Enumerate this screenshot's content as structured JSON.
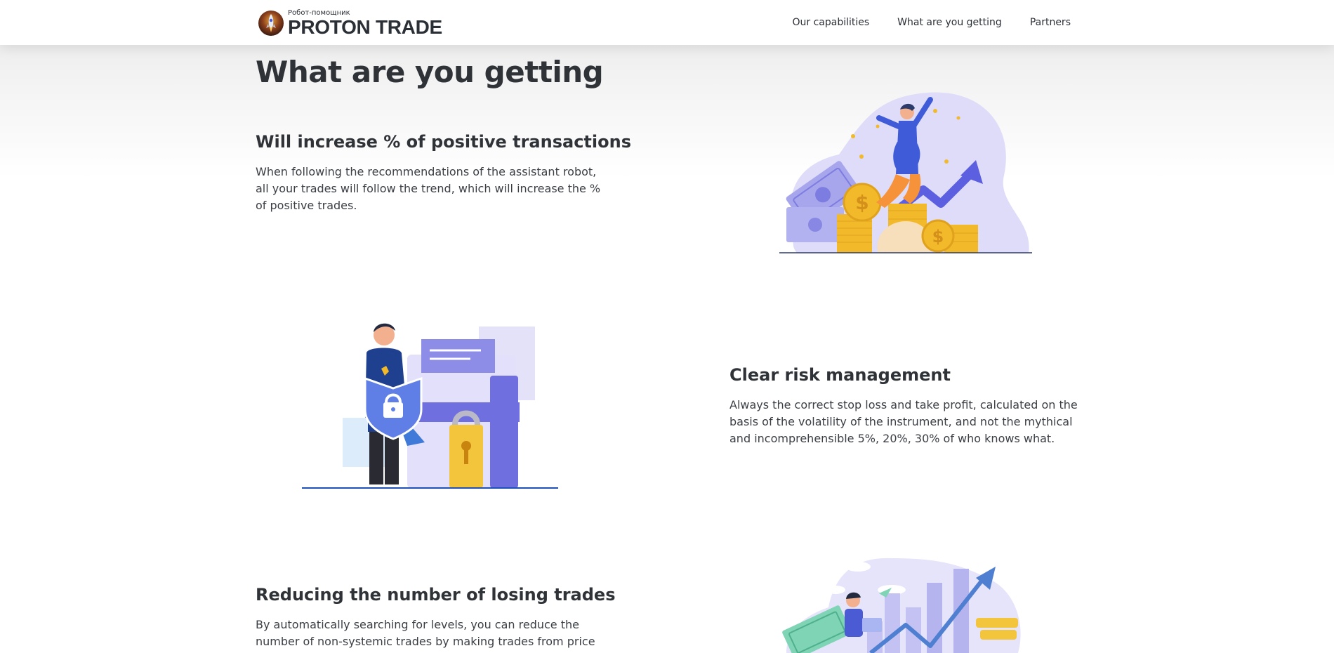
{
  "header": {
    "logo_subtitle": "Робот-помощник",
    "logo_title": "PROTON TRADE",
    "nav": [
      {
        "label": "Our capabilities"
      },
      {
        "label": "What are you getting"
      },
      {
        "label": "Partners"
      }
    ]
  },
  "section": {
    "title": "What are you getting",
    "features": [
      {
        "title": "Will increase % of positive transactions",
        "text": "When following the recommendations of the assistant robot, all your trades will follow the trend, which will increase the % of positive trades."
      },
      {
        "title": "Clear risk management",
        "text": "Always the correct stop loss and take profit, calculated on the basis of the volatility of the instrument, and not the mythical and incomprehensible 5%, 20%, 30% of who knows what."
      },
      {
        "title": "Reducing the number of losing trades",
        "text": "By automatically searching for levels, you can reduce the number of non-systemic trades by making trades from price"
      }
    ]
  },
  "colors": {
    "text": "#2f3338",
    "accent_blue": "#4a5bd4",
    "lavender": "#dcdaf7",
    "gold": "#f2b92b"
  }
}
